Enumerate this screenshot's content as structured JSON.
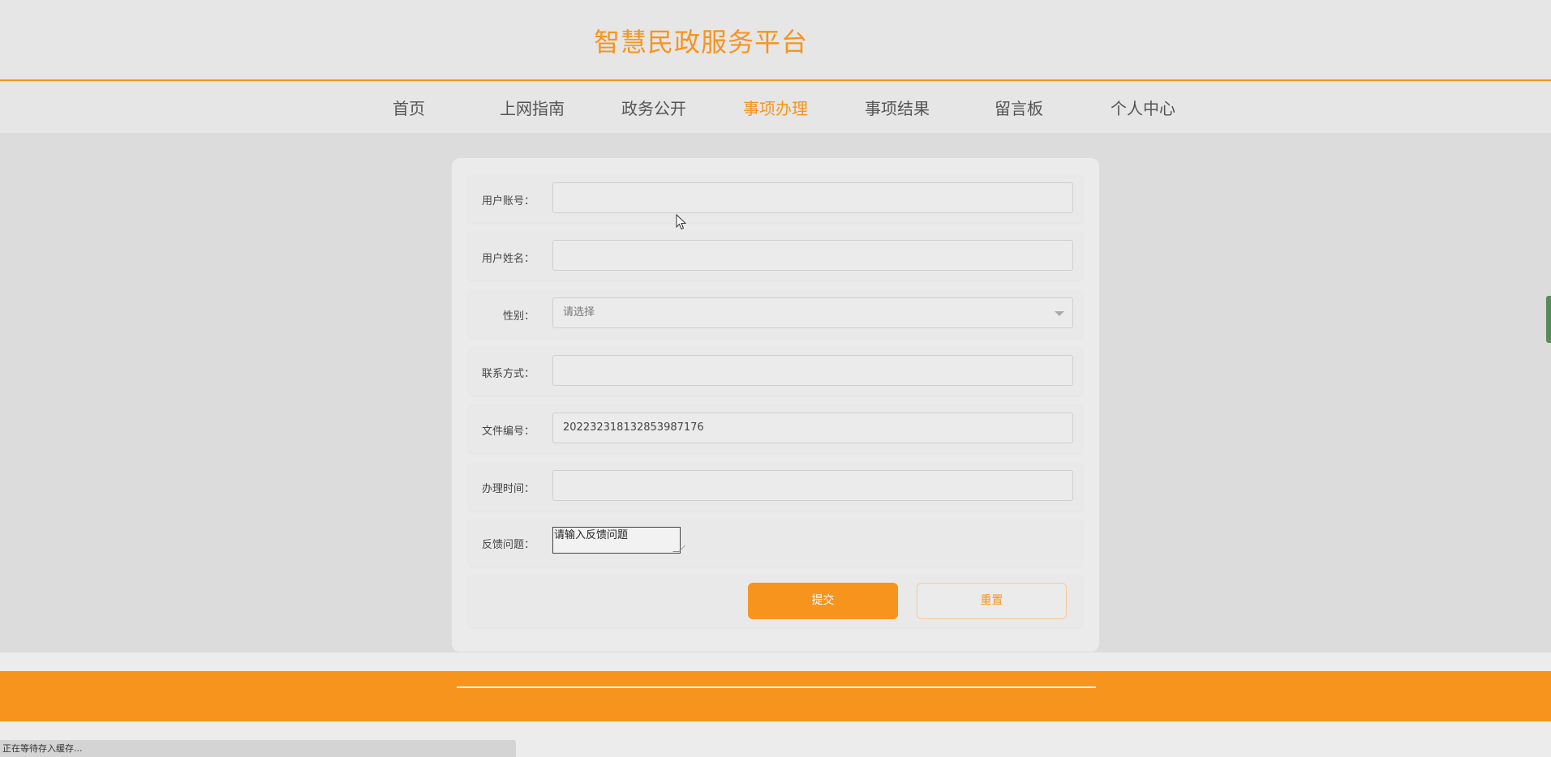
{
  "site": {
    "title": "智慧民政服务平台"
  },
  "nav": {
    "items": [
      {
        "label": "首页"
      },
      {
        "label": "上网指南"
      },
      {
        "label": "政务公开"
      },
      {
        "label": "事项办理"
      },
      {
        "label": "事项结果"
      },
      {
        "label": "留言板"
      },
      {
        "label": "个人中心"
      }
    ],
    "active_index": 3
  },
  "form": {
    "account": {
      "label": "用户账号：",
      "value": ""
    },
    "name": {
      "label": "用户姓名：",
      "value": ""
    },
    "gender": {
      "label": "性别：",
      "selected": "请选择"
    },
    "contact": {
      "label": "联系方式：",
      "value": ""
    },
    "file_no": {
      "label": "文件编号：",
      "value": "20223231813285398717​6"
    },
    "handle_time": {
      "label": "办理时间：",
      "value": ""
    },
    "feedback": {
      "label": "反馈问题：",
      "value": "请输入反馈问题"
    },
    "submit_label": "提交",
    "reset_label": "重置"
  },
  "status_bar": {
    "text": "正在等待存入缓存..."
  },
  "colors": {
    "accent": "#f7941d",
    "background": "#dcdcdc",
    "header": "#e6e6e6"
  }
}
